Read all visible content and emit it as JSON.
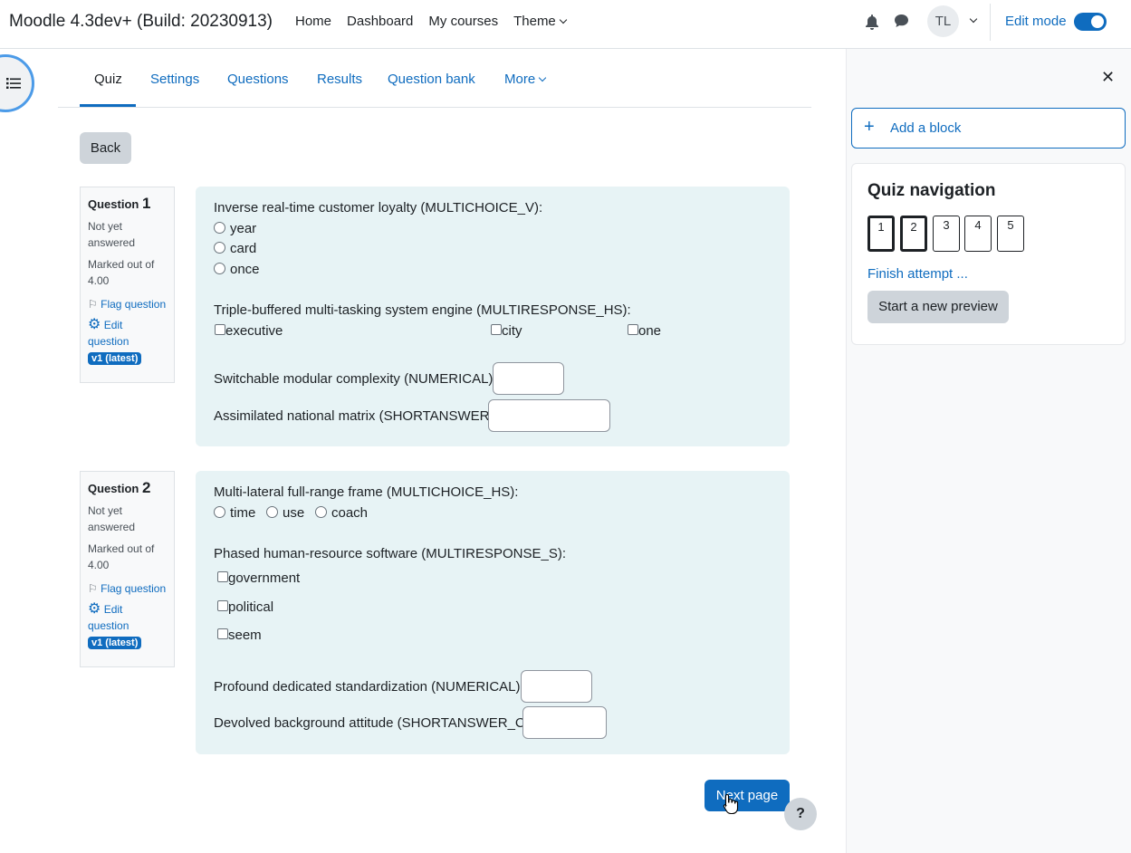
{
  "header": {
    "brand": "Moodle 4.3dev+ (Build: 20230913)",
    "nav": [
      "Home",
      "Dashboard",
      "My courses",
      "Theme"
    ],
    "avatar_initials": "TL",
    "edit_mode_label": "Edit mode",
    "edit_mode_on": true
  },
  "secondary_nav": {
    "tabs": [
      "Quiz",
      "Settings",
      "Questions",
      "Results",
      "Question bank",
      "More"
    ],
    "active": "Quiz"
  },
  "back_label": "Back",
  "questions": [
    {
      "label": "Question",
      "number": "1",
      "status": "Not yet answered",
      "marked": "Marked out of 4.00",
      "flag": "Flag question",
      "edit": "Edit question",
      "version": "v1 (latest)",
      "parts": {
        "mc_prompt": "Inverse real-time customer loyalty (MULTICHOICE_V):",
        "mc_options": [
          "year",
          "card",
          "once"
        ],
        "mr_prompt": "Triple-buffered multi-tasking system engine (MULTIRESPONSE_HS):",
        "mr_options": [
          "executive",
          "city",
          "one"
        ],
        "num_prompt": "Switchable modular complexity (NUMERICAL):",
        "sa_prompt": "Assimilated national matrix (SHORTANSWER):"
      }
    },
    {
      "label": "Question",
      "number": "2",
      "status": "Not yet answered",
      "marked": "Marked out of 4.00",
      "flag": "Flag question",
      "edit": "Edit question",
      "version": "v1 (latest)",
      "parts": {
        "mc_prompt": "Multi-lateral full-range frame (MULTICHOICE_HS):",
        "mc_options": [
          "time",
          "use",
          "coach"
        ],
        "mr_prompt": "Phased human-resource software (MULTIRESPONSE_S):",
        "mr_options": [
          "government",
          "political",
          "seem"
        ],
        "num_prompt": "Profound dedicated standardization (NUMERICAL):",
        "sa_prompt": "Devolved background attitude (SHORTANSWER_C):"
      }
    }
  ],
  "next_page_label": "Next page",
  "help_label": "?",
  "drawer": {
    "add_block": "Add a block",
    "quiz_nav_title": "Quiz navigation",
    "nav_numbers": [
      "1",
      "2",
      "3",
      "4",
      "5"
    ],
    "finish_attempt": "Finish attempt ...",
    "start_preview": "Start a new preview"
  },
  "colors": {
    "primary": "#0f6cbf",
    "question_bg": "#e7f3f5",
    "secondary_btn": "#ced4da"
  }
}
